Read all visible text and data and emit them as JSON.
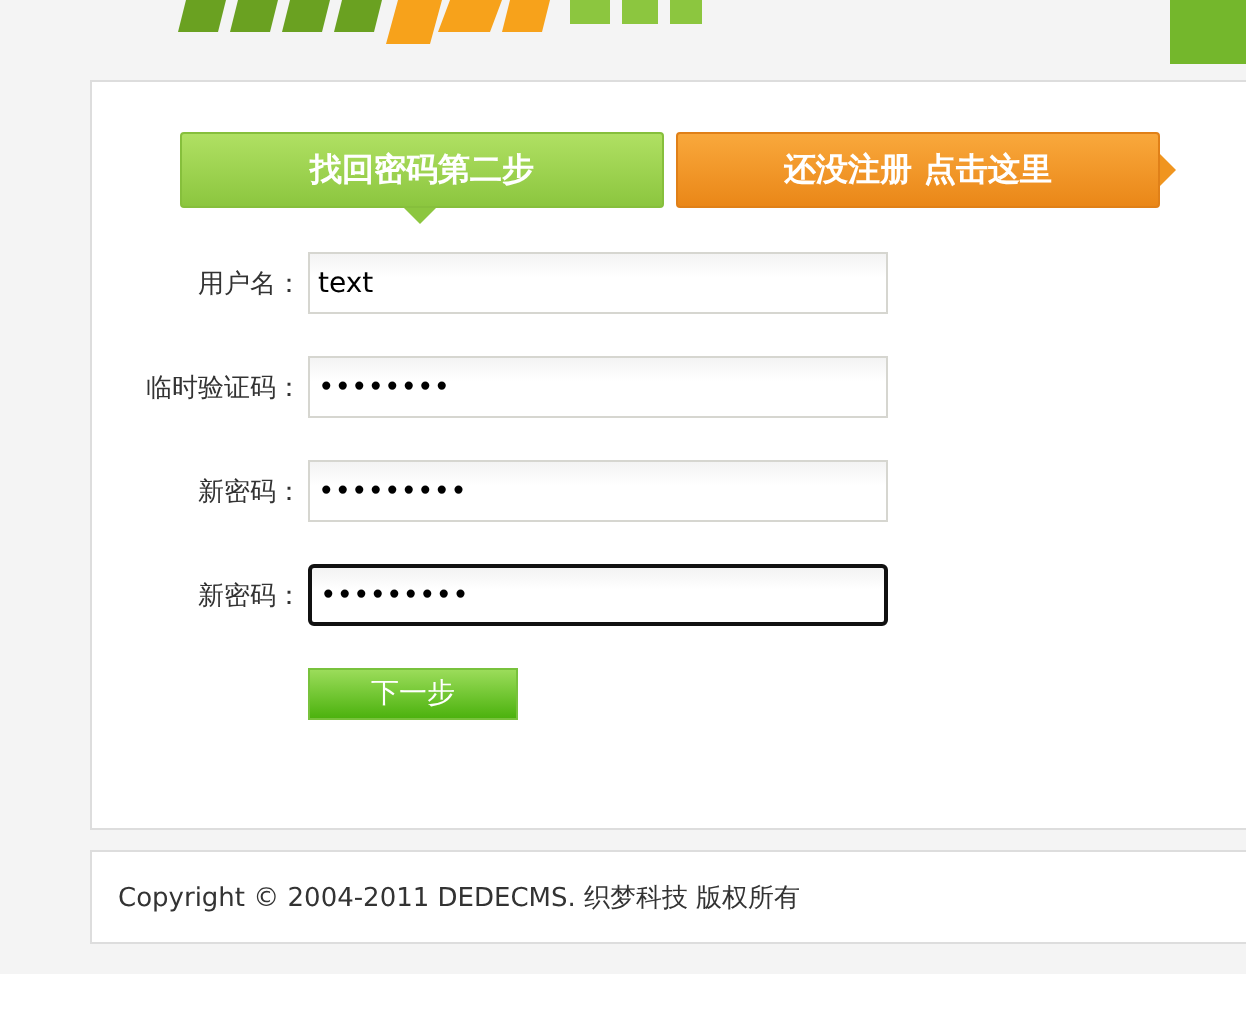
{
  "steps": [
    {
      "label": "找回密码第二步",
      "kind": "current"
    },
    {
      "label": "还没注册 点击这里",
      "kind": "link"
    }
  ],
  "fields": [
    {
      "label": "用户名：",
      "value": "text",
      "focused": false
    },
    {
      "label": "临时验证码：",
      "value": "••••••••",
      "focused": false
    },
    {
      "label": "新密码：",
      "value": "•••••••••",
      "focused": false
    },
    {
      "label": "新密码：",
      "value": "•••••••••",
      "focused": true
    }
  ],
  "submit": "下一步",
  "footer": "Copyright © 2004-2011 DEDECMS. 织梦科技 版权所有"
}
